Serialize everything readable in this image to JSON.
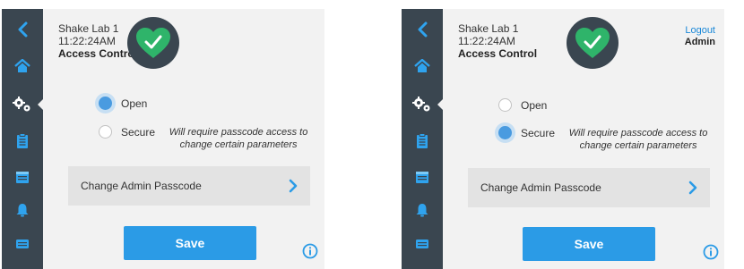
{
  "screens": [
    {
      "device_name": "Shake Lab 1",
      "time": "11:22:24AM",
      "page_title": "Access Control",
      "options": [
        {
          "label": "Open",
          "selected": true
        },
        {
          "label": "Secure",
          "selected": false,
          "note": "Will require passcode access to change certain parameters"
        }
      ],
      "change_passcode_label": "Change Admin Passcode",
      "save_label": "Save"
    },
    {
      "device_name": "Shake Lab 1",
      "time": "11:22:24AM",
      "page_title": "Access Control",
      "logout_label": "Logout",
      "user_label": "Admin",
      "options": [
        {
          "label": "Open",
          "selected": false
        },
        {
          "label": "Secure",
          "selected": true,
          "note": "Will require passcode access to change certain parameters"
        }
      ],
      "change_passcode_label": "Change Admin Passcode",
      "save_label": "Save"
    }
  ],
  "sidebar_icons": [
    "back-chevron-icon",
    "home-icon",
    "gears-icon",
    "clipboard-icon",
    "calendar-icon",
    "bell-icon",
    "keyboard-icon"
  ],
  "colors": {
    "sidebar": "#3a4650",
    "accent": "#2b9be6",
    "badge_green": "#2fb46a",
    "panel": "#f2f2f2"
  }
}
